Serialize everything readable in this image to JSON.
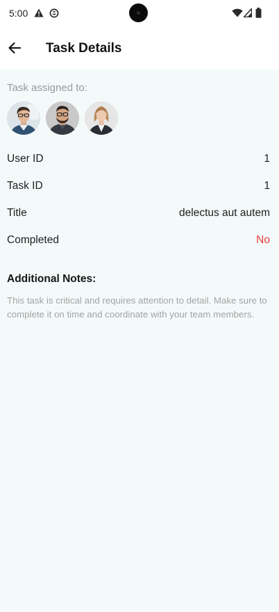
{
  "status_bar": {
    "time": "5:00",
    "left_icons": [
      "warning-icon",
      "sync-icon"
    ],
    "right_icons": [
      "wifi-icon",
      "signal-icon",
      "battery-icon"
    ]
  },
  "app_bar": {
    "back_icon": "arrow-left-icon",
    "title": "Task Details"
  },
  "assigned": {
    "label": "Task assigned to:",
    "avatars": [
      "avatar-1",
      "avatar-2",
      "avatar-3"
    ]
  },
  "details": {
    "user_id": {
      "label": "User ID",
      "value": "1"
    },
    "task_id": {
      "label": "Task ID",
      "value": "1"
    },
    "title": {
      "label": "Title",
      "value": "delectus aut autem"
    },
    "completed": {
      "label": "Completed",
      "value": "No",
      "value_color": "#E53935"
    }
  },
  "notes": {
    "heading": "Additional Notes:",
    "text": "This task is critical and requires attention to detail. Make sure to complete it on time and coordinate with your team members."
  },
  "colors": {
    "background": "#F4FAFA",
    "surface": "#FFFFFF",
    "muted_text": "#9A9A9A",
    "negative": "#E53935"
  }
}
